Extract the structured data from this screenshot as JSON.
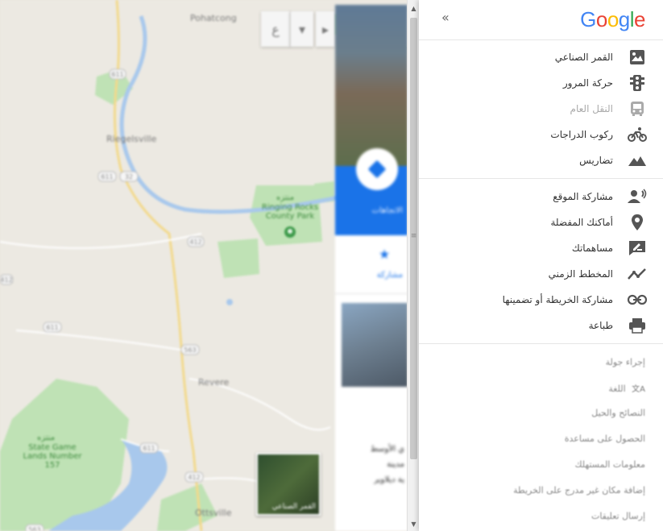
{
  "map": {
    "labels": {
      "pohatcong": "Pohatcong",
      "riegelsville": "Riegelsville",
      "park": "Ringing Rocks County Park",
      "park_ar": "منتزه",
      "revere": "Revere",
      "game_lands": "State Game Lands Number 157",
      "game_lands_ar": "منتزه",
      "ottsville": "Ottsville"
    },
    "route_shields": [
      "611",
      "611",
      "32",
      "412",
      "412",
      "611",
      "563",
      "611",
      "412",
      "563"
    ],
    "satellite_thumb_label": "القمر الصناعي"
  },
  "search": {
    "close_glyph": "✕",
    "search_glyph": "⌕",
    "dropdown_glyph": "▾",
    "play_glyph": "▸",
    "lang_glyph": "ع"
  },
  "place_panel": {
    "directions_label": "الاتجاهات",
    "share_label": "مشاركة",
    "text_lines": [
      "ي الأوسط",
      "مدينة",
      "ية ديلاوير"
    ]
  },
  "menu": {
    "collapse_glyph": "«",
    "logo_letters": [
      {
        "ch": "G",
        "color": "#4285F4"
      },
      {
        "ch": "o",
        "color": "#EA4335"
      },
      {
        "ch": "o",
        "color": "#FBBC05"
      },
      {
        "ch": "g",
        "color": "#4285F4"
      },
      {
        "ch": "l",
        "color": "#34A853"
      },
      {
        "ch": "e",
        "color": "#EA4335"
      }
    ],
    "layers": [
      {
        "label": "القمر الصناعي",
        "icon": "satellite-icon"
      },
      {
        "label": "حركة المرور",
        "icon": "traffic-icon"
      },
      {
        "label": "النقل العام",
        "icon": "transit-icon",
        "disabled": true
      },
      {
        "label": "ركوب الدراجات",
        "icon": "bicycle-icon"
      },
      {
        "label": "تضاريس",
        "icon": "terrain-icon"
      }
    ],
    "actions": [
      {
        "label": "مشاركة الموقع",
        "icon": "location-sharing-icon"
      },
      {
        "label": "أماكنك المفضلة",
        "icon": "place-pin-icon"
      },
      {
        "label": "مساهماتك",
        "icon": "contributions-icon"
      },
      {
        "label": "المخطط الزمني",
        "icon": "timeline-icon"
      },
      {
        "label": "مشاركة الخريطة أو تضمينها",
        "icon": "share-map-icon"
      },
      {
        "label": "طباعة",
        "icon": "print-icon"
      }
    ],
    "links": [
      "إجراء جولة",
      "اللغة",
      "النصائح والحيل",
      "الحصول على مساعدة",
      "معلومات المستهلك",
      "إضافة مكان غير مدرج على الخريطة",
      "إرسال تعليقات"
    ],
    "lang_icon": "文A"
  },
  "scrollbar": {
    "up": "▲",
    "down": "▼",
    "grip": "≡"
  }
}
